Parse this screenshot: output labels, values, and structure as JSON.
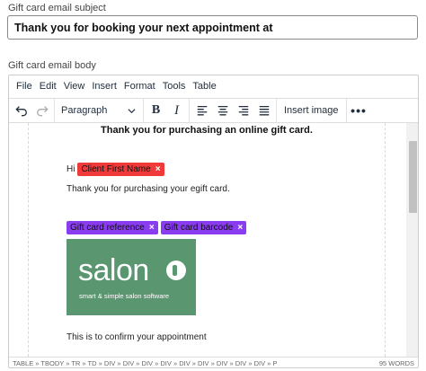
{
  "subject": {
    "label": "Gift card email subject",
    "value": "Thank you for booking your next appointment at"
  },
  "body": {
    "label": "Gift card email body"
  },
  "menubar": {
    "items": [
      "File",
      "Edit",
      "View",
      "Insert",
      "Format",
      "Tools",
      "Table"
    ]
  },
  "toolbar": {
    "block_format": "Paragraph",
    "insert_image": "Insert image",
    "icons": [
      "undo-icon",
      "redo-icon",
      "chevron-down-icon",
      "bold-icon",
      "italic-icon",
      "align-left-icon",
      "align-center-icon",
      "align-right-icon",
      "align-justify-icon",
      "more-icon"
    ]
  },
  "content": {
    "heading": "Thank you for purchasing an online gift card.",
    "greeting": "Hi",
    "tag_first_name": "Client First Name",
    "thank_line": "Thank you for purchasing your egift card.",
    "tag_reference": "Gift card reference",
    "tag_barcode": "Gift card barcode",
    "close_glyph": "×",
    "logo": {
      "word": "salon",
      "tagline": "smart & simple salon software",
      "background": "#5a9670"
    },
    "confirm_line": "This is to confirm your appointment"
  },
  "statusbar": {
    "path": "TABLE » TBODY » TR » TD » DIV » DIV » DIV » DIV » DIV » DIV » DIV » DIV » DIV » P",
    "word_count": "95 WORDS"
  },
  "colors": {
    "tag_red": "#f03a3a",
    "tag_purple": "#8a3df0"
  }
}
